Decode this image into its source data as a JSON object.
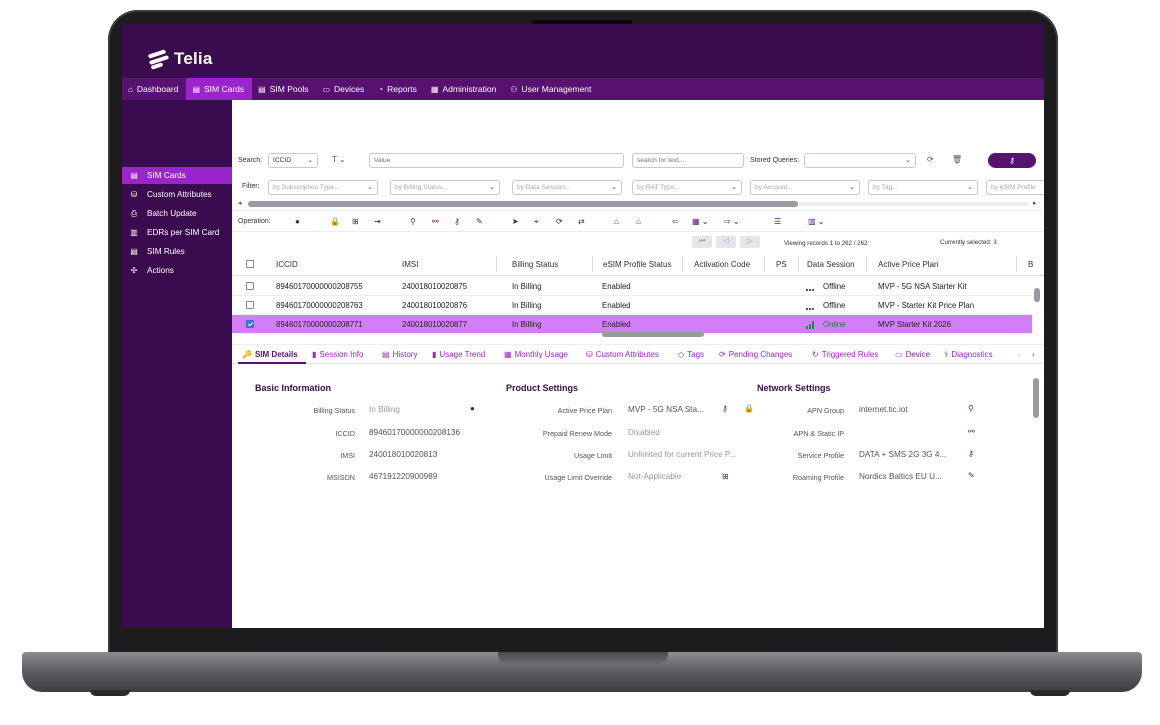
{
  "brand": {
    "name": "Telia"
  },
  "nav": [
    {
      "label": "Dashboard",
      "icon": "home-icon",
      "glyph": "⌂"
    },
    {
      "label": "SIM Cards",
      "icon": "sim-card-icon",
      "glyph": "▤"
    },
    {
      "label": "SIM Pools",
      "icon": "sim-pool-icon",
      "glyph": "▤"
    },
    {
      "label": "Devices",
      "icon": "device-icon",
      "glyph": "▭"
    },
    {
      "label": "Reports",
      "icon": "reports-icon",
      "glyph": "◔"
    },
    {
      "label": "Administration",
      "icon": "administration-icon",
      "glyph": "▦"
    },
    {
      "label": "User Management",
      "icon": "user-management-icon",
      "glyph": "⚇"
    }
  ],
  "sidebar": [
    {
      "label": "SIM Cards",
      "icon": "sim-card-icon",
      "glyph": "▤"
    },
    {
      "label": "Custom Attributes",
      "icon": "custom-attributes-icon",
      "glyph": "⛁"
    },
    {
      "label": "Batch Update",
      "icon": "batch-update-icon",
      "glyph": "⎙"
    },
    {
      "label": "EDRs per SIM Card",
      "icon": "edr-icon",
      "glyph": "▥"
    },
    {
      "label": "SIM Rules",
      "icon": "sim-rules-icon",
      "glyph": "▤"
    },
    {
      "label": "Actions",
      "icon": "actions-icon",
      "glyph": "✣"
    }
  ],
  "search": {
    "label": "Search:",
    "field": "ICCID",
    "value_placeholder": "Value",
    "text_placeholder": "search for text...",
    "stored_label": "Stored Queries:"
  },
  "filter": {
    "label": "Filter:",
    "items": [
      "by Subscription Type...",
      "by Billing Status...",
      "by Data Session...",
      "by RAT Type...",
      "by Account...",
      "by Tag...",
      "by eSIM Profile"
    ]
  },
  "operation": {
    "label": "Operation:"
  },
  "pager": {
    "viewing": "Viewing records 1 to 262 / 262",
    "selected": "Currently selected: 3"
  },
  "grid": {
    "columns": [
      "ICCID",
      "IMSI",
      "Billing Status",
      "eSIM Profile Status",
      "Activation Code",
      "PS",
      "Data Session",
      "Active Price Plan",
      "B"
    ],
    "rows": [
      {
        "iccid": "89460170000000208755",
        "imsi": "240018010020875",
        "billing": "In Billing",
        "esim": "Enabled",
        "session": "Offline",
        "plan": "MVP - 5G NSA Starter Kit",
        "checked": false
      },
      {
        "iccid": "89460170000000208763",
        "imsi": "240018010020876",
        "billing": "In Billing",
        "esim": "Enabled",
        "session": "Offline",
        "plan": "MVP - Starter Kit Price Plan",
        "checked": false
      },
      {
        "iccid": "89460170000000208771",
        "imsi": "240018010020877",
        "billing": "In Billing",
        "esim": "Enabled",
        "session": "Online",
        "plan": "MVP Starter Kit 2026",
        "checked": true
      }
    ]
  },
  "tabs": [
    {
      "label": "SIM Details",
      "glyph": "🔑"
    },
    {
      "label": "Session Info",
      "glyph": "▮"
    },
    {
      "label": "History",
      "glyph": "▤"
    },
    {
      "label": "Usage Trend",
      "glyph": "▮"
    },
    {
      "label": "Monthly Usage",
      "glyph": "▦"
    },
    {
      "label": "Custom Attributes",
      "glyph": "⛁"
    },
    {
      "label": "Tags",
      "glyph": "◇"
    },
    {
      "label": "Pending Changes",
      "glyph": "⟳"
    },
    {
      "label": "Triggered Rules",
      "glyph": "↻"
    },
    {
      "label": "Device",
      "glyph": "▭"
    },
    {
      "label": "Diagnostics",
      "glyph": "⚕"
    }
  ],
  "details": {
    "basic": {
      "title": "Basic Information",
      "fields": [
        {
          "label": "Billing Status",
          "value": "In Billing"
        },
        {
          "label": "ICCID",
          "value": "89460170000000208136"
        },
        {
          "label": "IMSI",
          "value": "240018010020813"
        },
        {
          "label": "MSISDN",
          "value": "467191220900989"
        }
      ]
    },
    "product": {
      "title": "Product Settings",
      "fields": [
        {
          "label": "Active Price Plan",
          "value": "MVP - 5G NSA Sta..."
        },
        {
          "label": "Prepaid Renew Mode",
          "value": "Disabled"
        },
        {
          "label": "Usage Limit",
          "value": "Unlimited for current Price P..."
        },
        {
          "label": "Usage Limit Override",
          "value": "Not-Applicable"
        }
      ]
    },
    "network": {
      "title": "Network Settings",
      "fields": [
        {
          "label": "APN Group",
          "value": "internet.tic.iot"
        },
        {
          "label": "APN & Static IP",
          "value": ""
        },
        {
          "label": "Service Profile",
          "value": "DATA + SMS 2G 3G 4..."
        },
        {
          "label": "Roaming Profile",
          "value": "Nordics Baltics EU U..."
        }
      ]
    }
  },
  "colors": {
    "header": "#3a0b4e",
    "nav": "#57116e",
    "accent": "#9b25cc",
    "selected_row": "#d27ef7"
  }
}
